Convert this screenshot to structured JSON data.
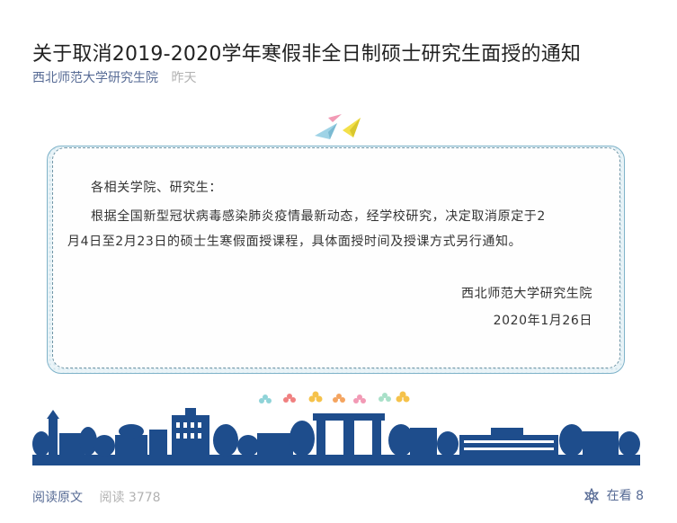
{
  "article": {
    "title": "关于取消2019-2020学年寒假非全日制硕士研究生面授的通知",
    "source": "西北师范大学研究生院",
    "time": "昨天"
  },
  "notice": {
    "greeting": "各相关学院、研究生：",
    "body_line1": "根据全国新型冠状病毒感染肺炎疫情最新动态，经学校研究，决定取消原定于2",
    "body_line2": "月4日至2月23日的硕士生寒假面授课程，具体面授时间及授课方式另行通知。",
    "signature": "西北师范大学研究生院",
    "date": "2020年1月26日"
  },
  "decor": {
    "planes_icon": "paper-plane-icon",
    "flowers_icon": "flower-icon",
    "skyline_image": "campus-skyline-illustration",
    "accent_color": "#1e4d8c"
  },
  "footer": {
    "read_original": "阅读原文",
    "read_label": "阅读",
    "read_count": "3778",
    "wow_label": "在看",
    "wow_count": "8"
  }
}
